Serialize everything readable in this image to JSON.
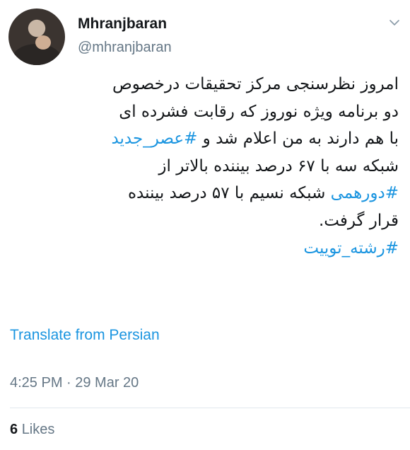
{
  "user": {
    "display_name": "Mhranjbaran",
    "handle": "@mhranjbaran"
  },
  "tweet": {
    "line1": "امروز نظرسنجی مرکز تحقیقات درخصوص",
    "line2": "دو برنامه ویژه نوروز که رقابت فشرده ای",
    "line3_text": "با هم دارند به من اعلام شد و ",
    "line3_hashtag": "#عصر_جدید",
    "line4": "شبکه سه با ۶۷ درصد بیننده بالاتر از",
    "line5_hashtag": "#دورهمی",
    "line5_text": " شبکه نسیم با ۵۷ درصد بیننده",
    "line6": "قرار گرفت.",
    "line7_hashtag": "#رشته_توییت"
  },
  "translate_label": "Translate from Persian",
  "timestamp": "4:25 PM · 29 Mar 20",
  "likes": {
    "count": "6",
    "label": "Likes"
  },
  "colors": {
    "link": "#1b95e0",
    "muted": "#657786",
    "text": "#14171a"
  },
  "icons": {
    "menu": "chevron-down-icon"
  }
}
